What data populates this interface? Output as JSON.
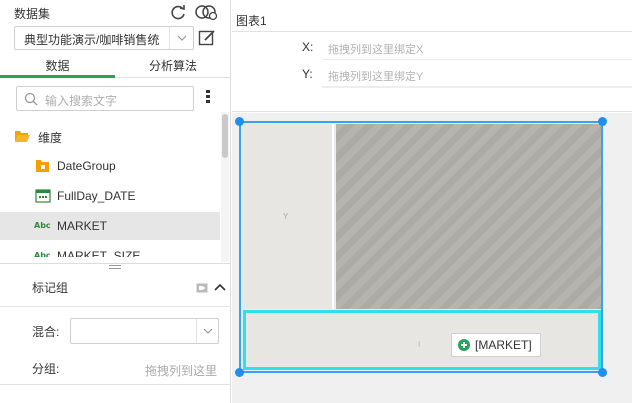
{
  "dataset": {
    "title": "数据集",
    "selected": "典型功能演示/咖啡销售统",
    "refresh_icon": "refresh-icon",
    "link_icon": "dataset-link-icon",
    "edit_icon": "edit-icon"
  },
  "tabs": [
    {
      "label": "数据",
      "active": true
    },
    {
      "label": "分析算法",
      "active": false
    }
  ],
  "search": {
    "placeholder": "输入搜索文字"
  },
  "tree": {
    "group_label": "维度",
    "items": [
      {
        "label": "DateGroup",
        "icon": "date-group-icon"
      },
      {
        "label": "FullDay_DATE",
        "icon": "calendar-icon"
      },
      {
        "label": "MARKET",
        "icon": "abc-text-icon",
        "selected": true
      },
      {
        "label": "MARKET_SIZE",
        "icon": "abc-text-icon"
      }
    ],
    "abc_text": "Abc"
  },
  "marks": {
    "title": "标记组",
    "mix_label": "混合:",
    "mix_value": "",
    "group_label": "分组:",
    "group_drop_hint": "拖拽列到这里"
  },
  "chart": {
    "title": "图表1",
    "x_label": "X:",
    "x_placeholder": "拖拽列到这里绑定X",
    "y_label": "Y:",
    "y_placeholder": "拖拽列到这里绑定Y",
    "y_axis_text": "Y",
    "x_axis_cursor": "I",
    "drop_pill": "[MARKET]"
  },
  "colors": {
    "accent_green": "#27a35a",
    "selection_blue": "#1e8ff0",
    "drop_highlight": "#2ee0ea"
  }
}
